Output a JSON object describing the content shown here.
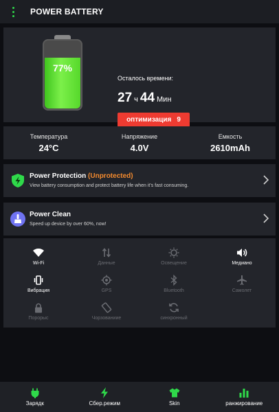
{
  "header": {
    "title": "POWER BATTERY",
    "menu_icon": "menu-dots-icon"
  },
  "battery": {
    "percent_label": "77%",
    "level": 0.77,
    "time_remaining_label": "Осталось времени:",
    "hours": "27",
    "hours_unit": "ч",
    "minutes": "44",
    "minutes_unit": "Мин",
    "optimize_label": "оптимизация",
    "optimize_count": "9"
  },
  "stats": [
    {
      "label": "Температура",
      "value": "24°C"
    },
    {
      "label": "Напряжение",
      "value": "4.0V"
    },
    {
      "label": "Емкость",
      "value": "2610mAh"
    }
  ],
  "protection": {
    "title": "Power Protection",
    "status": "(Unprotected)",
    "description": "View battery consumption and protect battery life when it's fast consuming."
  },
  "clean": {
    "title": "Power Clean",
    "description": "Speed up device by over 60%, now!"
  },
  "toggles": [
    {
      "label": "Wi-Fi",
      "icon": "wifi-icon",
      "active": true
    },
    {
      "label": "Данные",
      "icon": "data-icon",
      "active": false
    },
    {
      "label": "Освещение",
      "icon": "brightness-icon",
      "active": false
    },
    {
      "label": "Медиано",
      "icon": "volume-icon",
      "active": true
    },
    {
      "label": "Вибрация",
      "icon": "vibrate-icon",
      "active": true
    },
    {
      "label": "GPS",
      "icon": "gps-icon",
      "active": false
    },
    {
      "label": "Bluetooth",
      "icon": "bluetooth-icon",
      "active": false
    },
    {
      "label": "Самолет",
      "icon": "airplane-icon",
      "active": false
    },
    {
      "label": "Порорыс",
      "icon": "lock-icon",
      "active": false
    },
    {
      "label": "Чорзованиие",
      "icon": "rotate-icon",
      "active": false
    },
    {
      "label": "синхронный",
      "icon": "sync-icon",
      "active": false
    }
  ],
  "bottom_nav": [
    {
      "label": "Зарядк",
      "icon": "charger-icon"
    },
    {
      "label": "Сбер.режим",
      "icon": "bolt-icon"
    },
    {
      "label": "Skin",
      "icon": "shirt-icon"
    },
    {
      "label": "ранжирование",
      "icon": "ranking-icon"
    }
  ],
  "colors": {
    "accent_green": "#2fd94a",
    "warning_orange": "#f38a2e",
    "optimize_red": "#ee3b31",
    "card_bg": "#23252b",
    "inactive_gray": "#6a6c72"
  }
}
